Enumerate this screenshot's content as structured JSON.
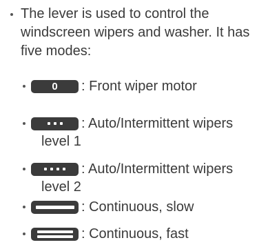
{
  "intro": {
    "lines": [
      "The lever is used to control the",
      "windscreen wipers and washer. It has",
      "five modes:"
    ]
  },
  "modes": [
    {
      "icon": "zero-badge-icon",
      "symbol": "0",
      "label": ": Front wiper motor"
    },
    {
      "icon": "three-dots-badge-icon",
      "label": ": Auto/Intermittent wipers",
      "label_cont": "level 1"
    },
    {
      "icon": "four-dots-badge-icon",
      "label": ": Auto/Intermittent wipers",
      "label_cont": "level 2"
    },
    {
      "icon": "single-bar-badge-icon",
      "label": ": Continuous, slow"
    },
    {
      "icon": "double-bar-badge-icon",
      "label": ": Continuous, fast"
    }
  ],
  "colors": {
    "text": "#3a3a3a",
    "badge": "#3b3b3b",
    "badge_symbol": "#ffffff"
  }
}
